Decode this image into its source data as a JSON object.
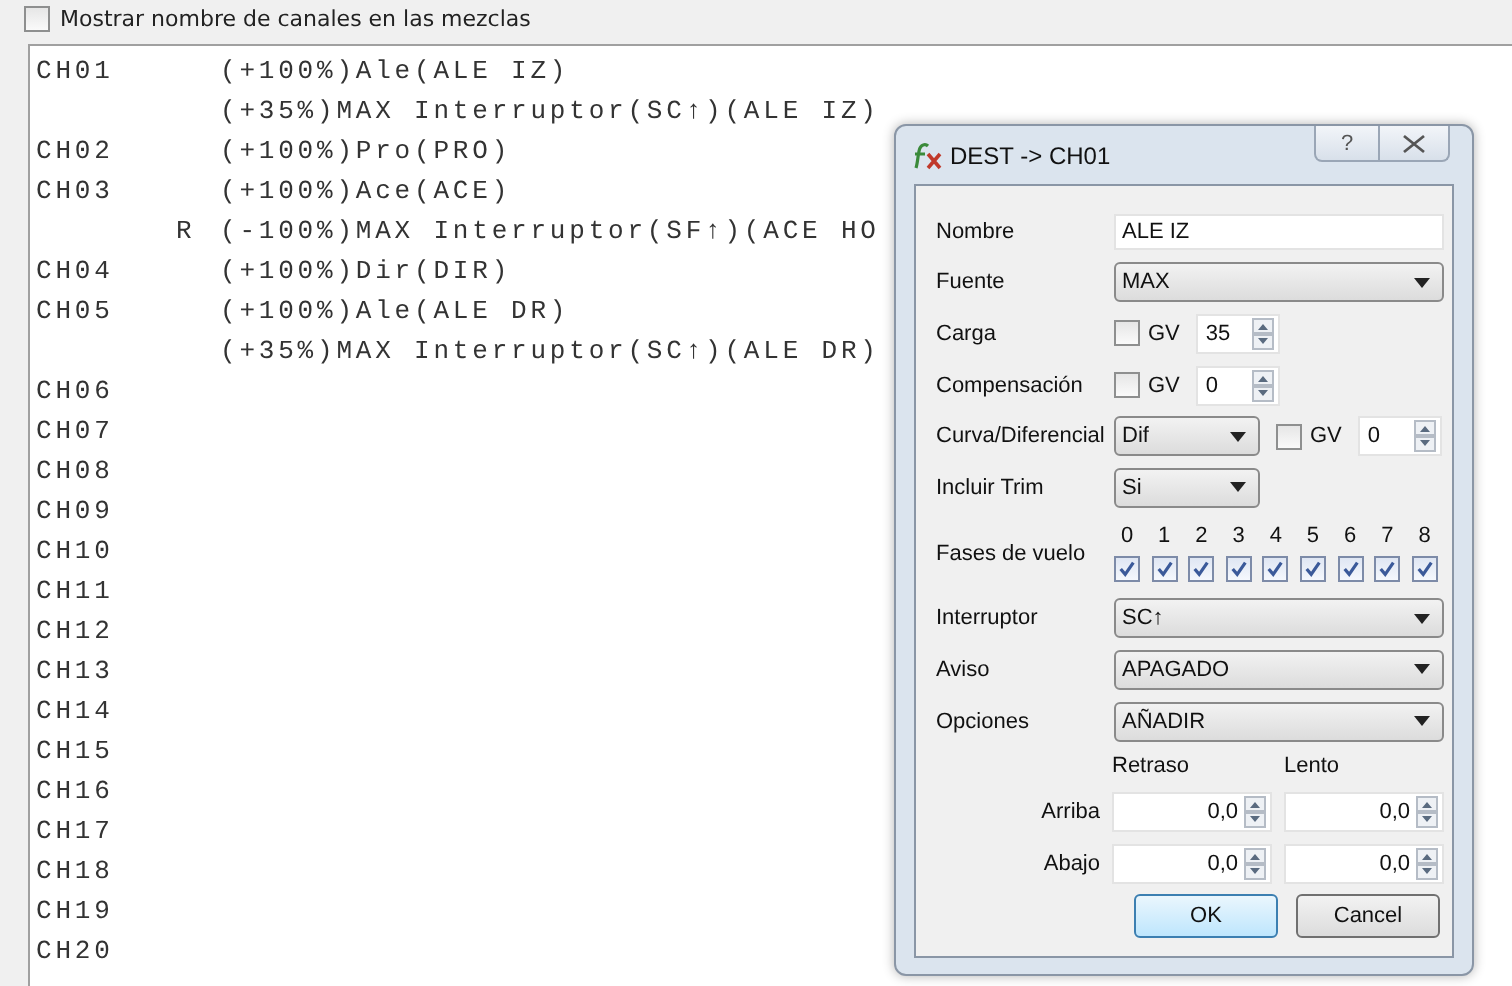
{
  "show_names_checkbox": {
    "label": "Mostrar nombre de canales en las mezclas",
    "checked": false
  },
  "mix_lines": [
    {
      "channel": "CH01",
      "text": "(+100%)Ale(ALE IZ)"
    },
    {
      "text": "(+35%)MAX Interruptor(SC↑)(ALE IZ)"
    },
    {
      "channel": "CH02",
      "text": "(+100%)Pro(PRO)"
    },
    {
      "channel": "CH03",
      "text": "(+100%)Ace(ACE)"
    },
    {
      "marker": "R",
      "text": "(-100%)MAX Interruptor(SF↑)(ACE HO"
    },
    {
      "channel": "CH04",
      "text": "(+100%)Dir(DIR)"
    },
    {
      "channel": "CH05",
      "text": "(+100%)Ale(ALE DR)"
    },
    {
      "text": "(+35%)MAX Interruptor(SC↑)(ALE DR)"
    },
    {
      "channel": "CH06"
    },
    {
      "channel": "CH07"
    },
    {
      "channel": "CH08"
    },
    {
      "channel": "CH09"
    },
    {
      "channel": "CH10"
    },
    {
      "channel": "CH11"
    },
    {
      "channel": "CH12"
    },
    {
      "channel": "CH13"
    },
    {
      "channel": "CH14"
    },
    {
      "channel": "CH15"
    },
    {
      "channel": "CH16"
    },
    {
      "channel": "CH17"
    },
    {
      "channel": "CH18"
    },
    {
      "channel": "CH19"
    },
    {
      "channel": "CH20"
    }
  ],
  "dialog": {
    "title": "DEST -> CH01",
    "help_button": "?",
    "fields": [
      {
        "kind": "text",
        "label": "Nombre",
        "value": "ALE IZ"
      },
      {
        "kind": "select",
        "label": "Fuente",
        "value": "MAX"
      },
      {
        "kind": "gv_spin",
        "label": "Carga",
        "gv_label": "GV",
        "gv_checked": false,
        "value": "35"
      },
      {
        "kind": "gv_spin",
        "label": "Compensación",
        "gv_label": "GV",
        "gv_checked": false,
        "value": "0"
      },
      {
        "kind": "select_gv_spin",
        "label": "Curva/Diferencial",
        "select": "Dif",
        "gv_label": "GV",
        "gv_checked": false,
        "value": "0"
      },
      {
        "kind": "short_select",
        "label": "Incluir Trim",
        "value": "Si"
      },
      {
        "kind": "phases",
        "label": "Fases de vuelo",
        "phases": [
          {
            "label": "0",
            "checked": true
          },
          {
            "label": "1",
            "checked": true
          },
          {
            "label": "2",
            "checked": true
          },
          {
            "label": "3",
            "checked": true
          },
          {
            "label": "4",
            "checked": true
          },
          {
            "label": "5",
            "checked": true
          },
          {
            "label": "6",
            "checked": true
          },
          {
            "label": "7",
            "checked": true
          },
          {
            "label": "8",
            "checked": true
          }
        ]
      },
      {
        "kind": "select",
        "label": "Interruptor",
        "value": "SC↑"
      },
      {
        "kind": "select",
        "label": "Aviso",
        "value": "APAGADO"
      },
      {
        "kind": "select",
        "label": "Opciones",
        "value": "AÑADIR"
      }
    ],
    "timing": {
      "columns": [
        "Retraso",
        "Lento"
      ],
      "rows": [
        {
          "label": "Arriba",
          "values": [
            "0,0",
            "0,0"
          ]
        },
        {
          "label": "Abajo",
          "values": [
            "0,0",
            "0,0"
          ]
        }
      ]
    },
    "buttons": [
      {
        "label": "OK",
        "default": true
      },
      {
        "label": "Cancel",
        "default": false
      }
    ]
  }
}
